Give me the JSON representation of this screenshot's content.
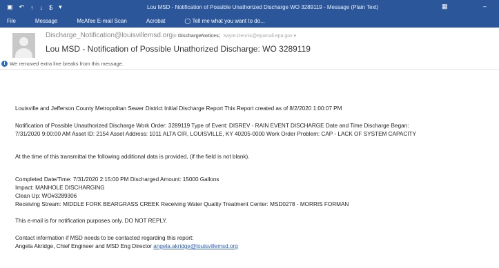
{
  "window": {
    "title": "Lou MSD - Notification of Possible Unathorized Discharge WO 3289119 - Message (Plain Text)"
  },
  "ribbon": {
    "tabs": [
      "File",
      "Message",
      "McAfee E-mail Scan",
      "Acrobat"
    ],
    "tell_me": "Tell me what you want to do..."
  },
  "message": {
    "from": "Discharge_Notification@louisvillemsd.org",
    "to_label": "DischargeNotices;",
    "to_extra": "Sayre.Dennis@epamail.epa.gov",
    "subject": "Lou MSD - Notification of Possible Unathorized Discharge: WO 3289119",
    "info": "We removed extra line breaks from this message."
  },
  "body": {
    "line1": "Louisville and Jefferson County Metropolitan Sewer District Initial Discharge Report This Report created as of 8/2/2020 1:00:07 PM",
    "line2a": "Notification of Possible Unauthorized Discharge Work Order: 3289119 Type of Event: DISREV - RAIN EVENT DISCHARGE Date and Time Discharge Began:",
    "line2b": "7/31/2020 9:00:00 AM Asset ID: 2154 Asset Address: 1011 ALTA CIR, LOUISVILLE, KY 40205-0000 Work Order Problem: CAP - LACK OF SYSTEM CAPACITY",
    "line3": "At the time of this transmittal the following additional data is provided, (if the field is not blank).",
    "line4": "Completed Date/Time: 7/31/2020 2:15:00 PM Discharged Amount: 15000 Gallons",
    "line5": "Impact: MANHOLE DISCHARGING",
    "line6": "Clean Up: WO#3289306",
    "line7": "Receiving Stream: MIDDLE FORK BEARGRASS CREEK Receiving Water Quality Treatment Center: MSD0278 - MORRIS FORMAN",
    "line8": "This e-mail is for notification purposes only. DO NOT REPLY.",
    "line9": "Contact information if MSD needs to be contacted regarding this report:",
    "line10": "Angela Akridge, Chief Engineer and MSD Eng Director",
    "email": "angela.akridge@louisvillemsd.org"
  }
}
